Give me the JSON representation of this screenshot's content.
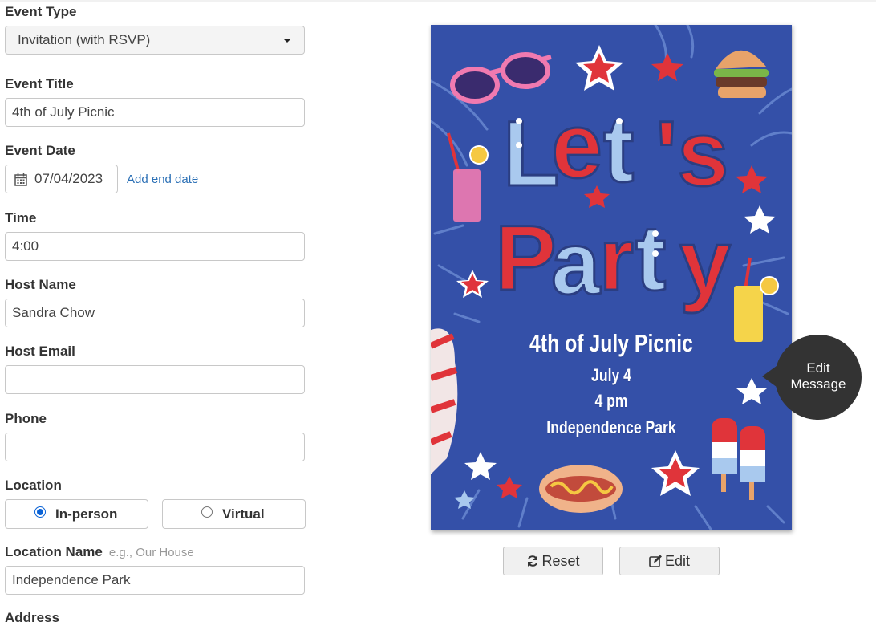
{
  "form": {
    "event_type": {
      "label": "Event Type",
      "value": "Invitation (with RSVP)"
    },
    "event_title": {
      "label": "Event Title",
      "value": "4th of July Picnic"
    },
    "event_date": {
      "label": "Event Date",
      "value": "07/04/2023",
      "add_end": "Add end date"
    },
    "time": {
      "label": "Time",
      "value": "4:00"
    },
    "host_name": {
      "label": "Host Name",
      "value": "Sandra Chow"
    },
    "host_email": {
      "label": "Host Email",
      "value": ""
    },
    "phone": {
      "label": "Phone",
      "value": ""
    },
    "location": {
      "label": "Location",
      "options": [
        "In-person",
        "Virtual"
      ],
      "selected": "In-person"
    },
    "location_name": {
      "label": "Location Name",
      "hint": "e.g., Our House",
      "value": "Independence Park"
    },
    "address": {
      "label": "Address"
    }
  },
  "card": {
    "headline": "Let's Party",
    "title": "4th of July Picnic",
    "date": "July 4",
    "time": "4 pm",
    "location": "Independence Park",
    "edit_bubble": [
      "Edit",
      "Message"
    ]
  },
  "buttons": {
    "reset": "Reset",
    "edit": "Edit"
  },
  "colors": {
    "card_bg": "#3450a8",
    "red": "#e0343a",
    "light_blue": "#a9c9ee",
    "link": "#2a6fb5",
    "radio_on": "#0b63d6"
  },
  "icons": [
    "caret-down-icon",
    "calendar-icon",
    "refresh-icon",
    "edit-icon"
  ]
}
